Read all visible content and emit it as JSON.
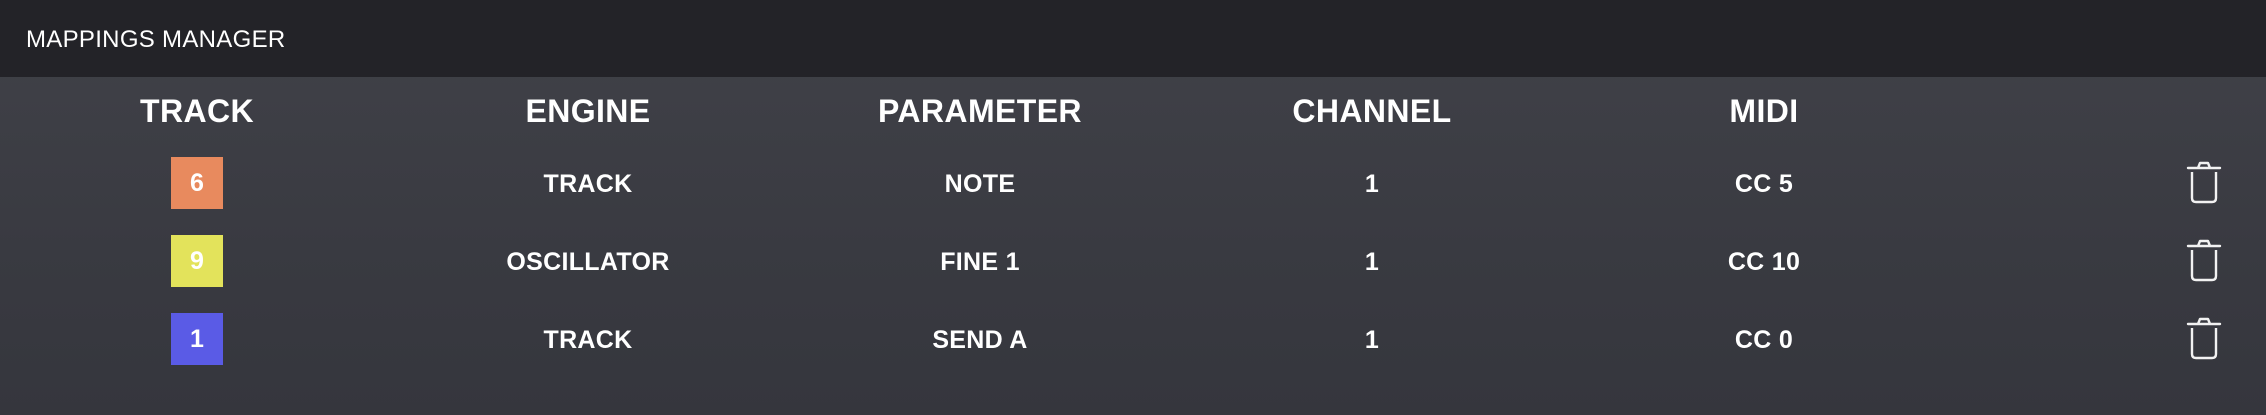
{
  "title": "MAPPINGS MANAGER",
  "headers": {
    "track": "TRACK",
    "engine": "ENGINE",
    "parameter": "PARAMETER",
    "channel": "CHANNEL",
    "midi": "MIDI"
  },
  "rows": [
    {
      "track": "6",
      "track_color": "#e88a5e",
      "engine": "TRACK",
      "parameter": "NOTE",
      "channel": "1",
      "midi": "CC 5"
    },
    {
      "track": "9",
      "track_color": "#e3e35b",
      "engine": "OSCILLATOR",
      "parameter": "FINE 1",
      "channel": "1",
      "midi": "CC 10"
    },
    {
      "track": "1",
      "track_color": "#5a5be6",
      "engine": "TRACK",
      "parameter": "SEND A",
      "channel": "1",
      "midi": "CC 0"
    }
  ],
  "icons": {
    "delete": "trash-icon"
  }
}
